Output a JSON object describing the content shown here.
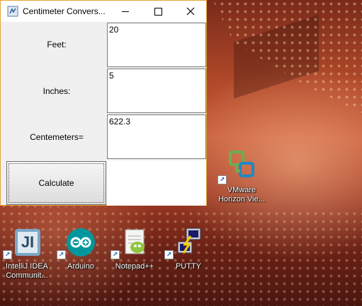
{
  "window": {
    "title": "Centimeter Convers...",
    "feet_label": "Feet:",
    "feet_value": "20",
    "inches_label": "Inches:",
    "inches_value": "5",
    "cm_label": "Centemeters=",
    "cm_value": "622.3",
    "calculate_label": "Calculate"
  },
  "desktop": {
    "icons": [
      {
        "label": "VMware Horizon Vie...",
        "icon": "vmware-horizon-icon"
      },
      {
        "label": "IntelliJ IDEA Communit...",
        "icon": "intellij-icon"
      },
      {
        "label": "Arduino",
        "icon": "arduino-icon"
      },
      {
        "label": "Notepad++",
        "icon": "notepadpp-icon"
      },
      {
        "label": "PUTTY",
        "icon": "putty-icon"
      }
    ]
  },
  "colors": {
    "window_border": "#e8a23a",
    "arduino": "#00979c",
    "vmware_green": "#6ab04c",
    "vmware_blue": "#1e88c8"
  }
}
